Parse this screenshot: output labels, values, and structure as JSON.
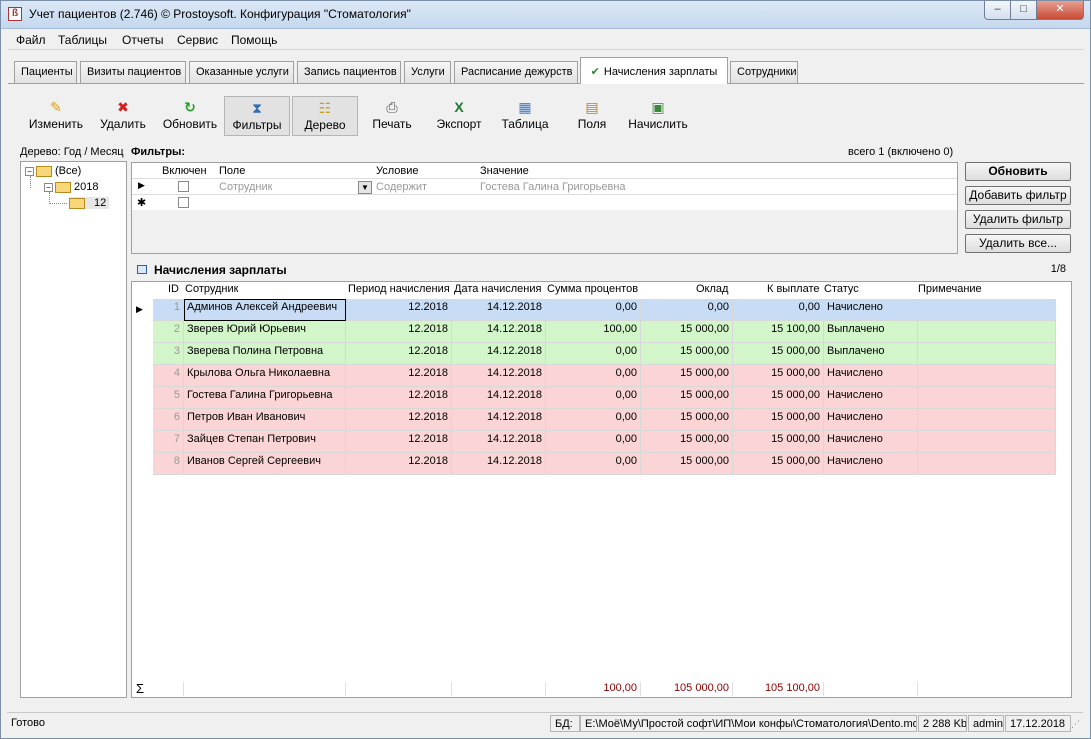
{
  "window": {
    "title": "Учет пациентов (2.746) © Prostoysoft. Конфигурация \"Стоматология\""
  },
  "menu": [
    "Файл",
    "Таблицы",
    "Отчеты",
    "Сервис",
    "Помощь"
  ],
  "tabs": [
    "Пациенты",
    "Визиты пациентов",
    "Оказанные услуги",
    "Запись пациентов",
    "Услуги",
    "Расписание дежурств",
    "Начисления зарплаты",
    "Сотрудники"
  ],
  "toolbar": [
    "Изменить",
    "Удалить",
    "Обновить",
    "Фильтры",
    "Дерево",
    "Печать",
    "Экспорт",
    "Таблица",
    "Поля",
    "Начислить"
  ],
  "tree": {
    "label": "Дерево: Год / Месяц",
    "nodes": [
      "(Все)",
      "2018",
      "12"
    ]
  },
  "filters": {
    "title": "Фильтры:",
    "count": "всего 1 (включено 0)",
    "headers": [
      "Включен",
      "Поле",
      "Условие",
      "Значение"
    ],
    "row": {
      "field": "Сотрудник",
      "condition": "Содержит",
      "value": "Гостева Галина Григорьевна"
    },
    "buttons": [
      "Обновить",
      "Добавить фильтр",
      "Удалить фильтр",
      "Удалить все..."
    ]
  },
  "grid": {
    "title": "Начисления зарплаты",
    "pages": "1/8",
    "headers": [
      "ID",
      "Сотрудник",
      "Период начисления",
      "Дата начисления",
      "Сумма процентов",
      "Оклад",
      "К выплате",
      "Статус",
      "Примечание"
    ],
    "rows": [
      [
        "1",
        "Админов Алексей Андреевич",
        "12.2018",
        "14.12.2018",
        "0,00",
        "0,00",
        "0,00",
        "Начислено",
        ""
      ],
      [
        "2",
        "Зверев Юрий Юрьевич",
        "12.2018",
        "14.12.2018",
        "100,00",
        "15 000,00",
        "15 100,00",
        "Выплачено",
        ""
      ],
      [
        "3",
        "Зверева Полина Петровна",
        "12.2018",
        "14.12.2018",
        "0,00",
        "15 000,00",
        "15 000,00",
        "Выплачено",
        ""
      ],
      [
        "4",
        "Крылова Ольга Николаевна",
        "12.2018",
        "14.12.2018",
        "0,00",
        "15 000,00",
        "15 000,00",
        "Начислено",
        ""
      ],
      [
        "5",
        "Гостева Галина Григорьевна",
        "12.2018",
        "14.12.2018",
        "0,00",
        "15 000,00",
        "15 000,00",
        "Начислено",
        ""
      ],
      [
        "6",
        "Петров Иван Иванович",
        "12.2018",
        "14.12.2018",
        "0,00",
        "15 000,00",
        "15 000,00",
        "Начислено",
        ""
      ],
      [
        "7",
        "Зайцев Степан Петрович",
        "12.2018",
        "14.12.2018",
        "0,00",
        "15 000,00",
        "15 000,00",
        "Начислено",
        ""
      ],
      [
        "8",
        "Иванов Сергей Сергеевич",
        "12.2018",
        "14.12.2018",
        "0,00",
        "15 000,00",
        "15 000,00",
        "Начислено",
        ""
      ]
    ],
    "row_colors": [
      "#c8dcf6",
      "#d2f5c9",
      "#d2f5c9",
      "#fbd5d5",
      "#fbd5d5",
      "#fbd5d5",
      "#fbd5d5",
      "#fbd5d5"
    ],
    "totals": {
      "sum_percent": "100,00",
      "salary": "105 000,00",
      "payout": "105 100,00"
    }
  },
  "statusbar": {
    "state": "Готово",
    "db_label": "БД:",
    "db_path": "E:\\Моё\\Му\\Простой софт\\ИП\\Мои конфы\\Стоматология\\Dento.mdb",
    "size": "2 288 Kb",
    "user": "admin",
    "date": "17.12.2018"
  }
}
